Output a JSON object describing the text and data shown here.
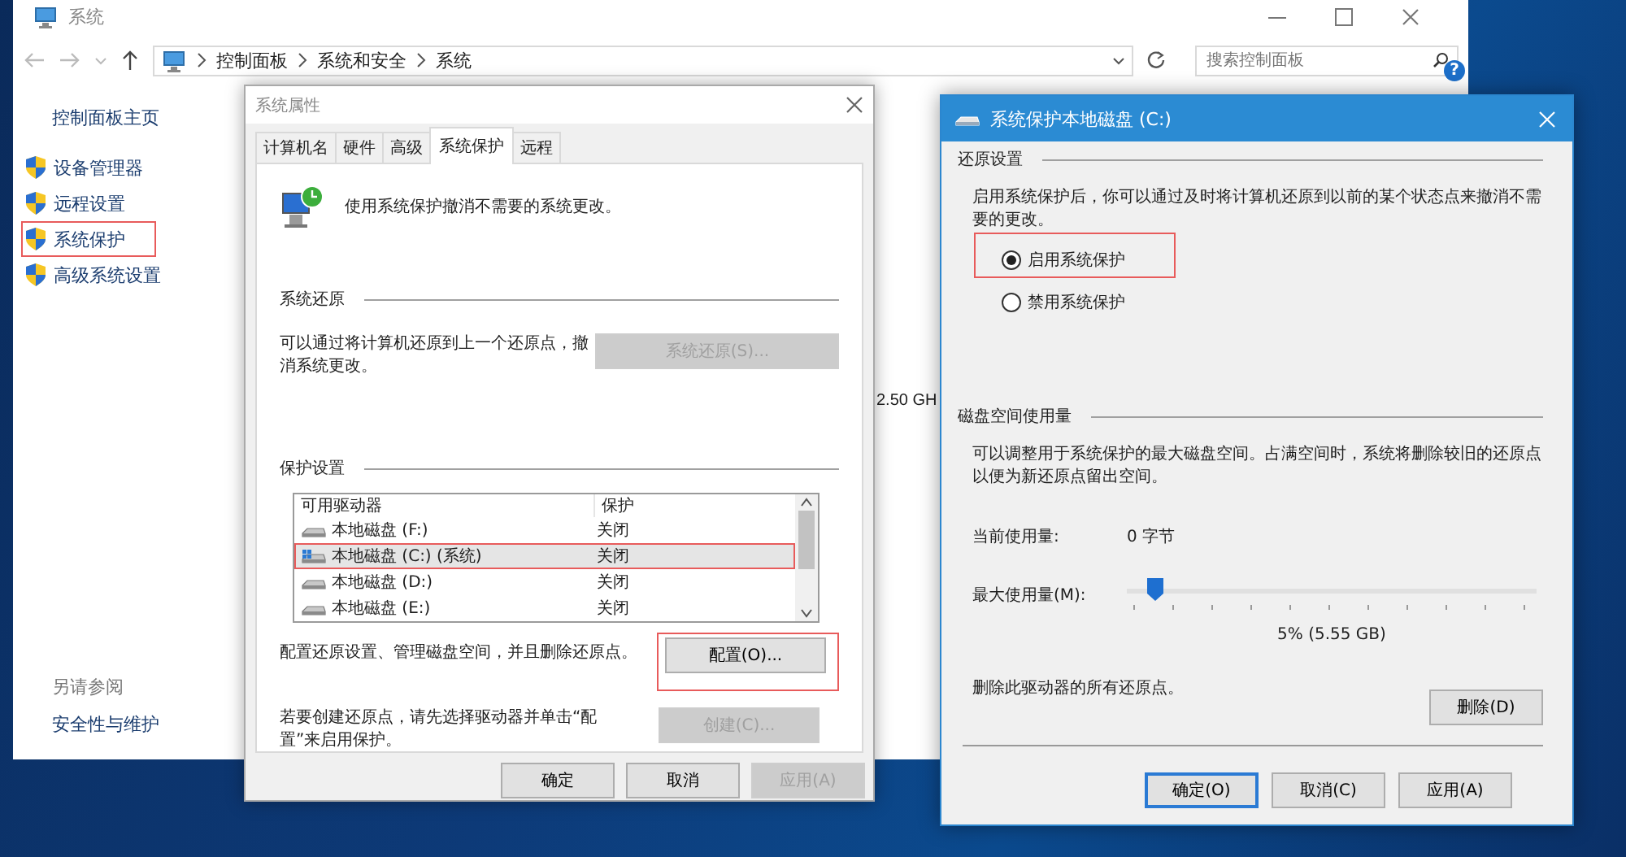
{
  "main_window": {
    "title": "系统",
    "breadcrumb": [
      "控制面板",
      "系统和安全",
      "系统"
    ],
    "search": {
      "placeholder": "搜索控制面板"
    },
    "help": "?",
    "sidebar": {
      "home": "控制面板主页",
      "items": [
        {
          "label": "设备管理器",
          "highlighted": false
        },
        {
          "label": "远程设置",
          "highlighted": false
        },
        {
          "label": "系统保护",
          "highlighted": true
        },
        {
          "label": "高级系统设置",
          "highlighted": false
        }
      ],
      "see_also": {
        "heading": "另请参阅",
        "links": [
          "安全性与维护"
        ]
      }
    },
    "content": {
      "processor_speed": "2.50 GH"
    }
  },
  "properties_dialog": {
    "title": "系统属性",
    "tabs": [
      {
        "label": "计算机名",
        "selected": false
      },
      {
        "label": "硬件",
        "selected": false
      },
      {
        "label": "高级",
        "selected": false
      },
      {
        "label": "系统保护",
        "selected": true
      },
      {
        "label": "远程",
        "selected": false
      }
    ],
    "intro": "使用系统保护撤消不需要的系统更改。",
    "restore": {
      "heading": "系统还原",
      "text": "可以通过将计算机还原到上一个还原点，撤消系统更改。",
      "button": {
        "label": "系统还原(S)...",
        "disabled": true
      }
    },
    "protection": {
      "heading": "保护设置",
      "columns": [
        "可用驱动器",
        "保护"
      ],
      "rows": [
        {
          "kind": "disk",
          "drive": "本地磁盘 (F:)",
          "protection": "关闭",
          "selected": false,
          "highlighted": false
        },
        {
          "kind": "system",
          "drive": "本地磁盘 (C:) (系统)",
          "protection": "关闭",
          "selected": true,
          "highlighted": true
        },
        {
          "kind": "disk",
          "drive": "本地磁盘 (D:)",
          "protection": "关闭",
          "selected": false,
          "highlighted": false
        },
        {
          "kind": "disk",
          "drive": "本地磁盘 (E:)",
          "protection": "关闭",
          "selected": false,
          "highlighted": false
        }
      ],
      "configure_text": "配置还原设置、管理磁盘空间，并且删除还原点。",
      "configure_button": {
        "label": "配置(O)...",
        "disabled": false,
        "highlighted": true
      },
      "create_text": "若要创建还原点，请先选择驱动器并单击“配置”来启用保护。",
      "create_button": {
        "label": "创建(C)...",
        "disabled": true
      }
    },
    "buttons": [
      {
        "label": "确定",
        "disabled": false
      },
      {
        "label": "取消",
        "disabled": false
      },
      {
        "label": "应用(A)",
        "disabled": true
      }
    ]
  },
  "protection_dialog": {
    "title": "系统保护本地磁盘 (C:)",
    "restore_settings": {
      "heading": "还原设置",
      "text": "启用系统保护后，你可以通过及时将计算机还原到以前的某个状态点来撤消不需要的更改。",
      "options": [
        {
          "label": "启用系统保护",
          "selected": true,
          "highlighted": true
        },
        {
          "label": "禁用系统保护",
          "selected": false,
          "highlighted": false
        }
      ]
    },
    "disk_usage": {
      "heading": "磁盘空间使用量",
      "text": "可以调整用于系统保护的最大磁盘空间。占满空间时，系统将删除较旧的还原点以便为新还原点留出空间。",
      "current_label": "当前使用量:",
      "current_value": "0 字节",
      "max_label": "最大使用量(M):",
      "level": 0.05,
      "max_value": "5% (5.55 GB)"
    },
    "delete_text": "删除此驱动器的所有还原点。",
    "delete_button": {
      "label": "删除(D)",
      "disabled": false
    },
    "buttons": [
      {
        "label": "确定(O)",
        "default": true,
        "disabled": false
      },
      {
        "label": "取消(C)",
        "default": false,
        "disabled": false
      },
      {
        "label": "应用(A)",
        "default": false,
        "disabled": false
      }
    ]
  }
}
